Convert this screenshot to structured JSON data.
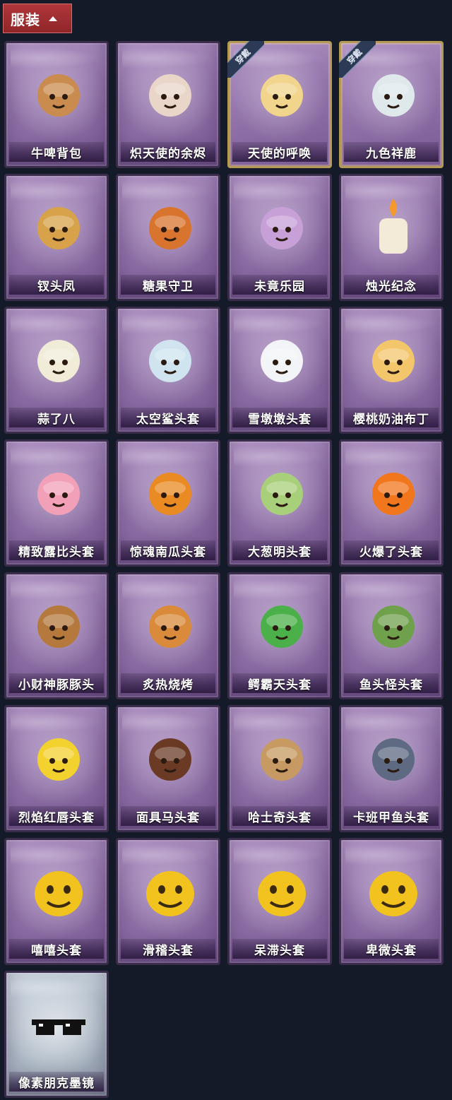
{
  "section": {
    "title": "服装"
  },
  "items": [
    {
      "name": "牛啤背包",
      "icon": "cow-beer-backpack-icon",
      "color": "#c98b4e",
      "equipped": false
    },
    {
      "name": "炽天使的余烬",
      "icon": "seraph-doll-icon",
      "color": "#e9d6c8",
      "equipped": false
    },
    {
      "name": "天使的呼唤",
      "icon": "angel-doll-icon",
      "color": "#f1d58c",
      "equipped": true,
      "badge": "穿戴"
    },
    {
      "name": "九色祥鹿",
      "icon": "deer-charm-icon",
      "color": "#dfe9ec",
      "equipped": true,
      "badge": "穿戴"
    },
    {
      "name": "钗头凤",
      "icon": "phoenix-crown-doll-icon",
      "color": "#d7a24a",
      "equipped": false
    },
    {
      "name": "糖果守卫",
      "icon": "pumpkin-scarecrow-icon",
      "color": "#d8742e",
      "equipped": false
    },
    {
      "name": "未竟乐园",
      "icon": "jester-doll-icon",
      "color": "#c7a0d8",
      "equipped": false
    },
    {
      "name": "烛光纪念",
      "icon": "candle-icon",
      "color": "#f4ead8",
      "equipped": false
    },
    {
      "name": "蒜了八",
      "icon": "garlic-icon",
      "color": "#f0ecd8",
      "equipped": false
    },
    {
      "name": "太空鲨头套",
      "icon": "shark-head-icon",
      "color": "#cfe4ef",
      "equipped": false
    },
    {
      "name": "雪墩墩头套",
      "icon": "snowman-head-icon",
      "color": "#f2f4f7",
      "equipped": false
    },
    {
      "name": "樱桃奶油布丁",
      "icon": "pudding-icon",
      "color": "#f3c66c",
      "equipped": false
    },
    {
      "name": "精致露比头套",
      "icon": "pink-beaver-head-icon",
      "color": "#f2a0b8",
      "equipped": false
    },
    {
      "name": "惊魂南瓜头套",
      "icon": "pumpkin-head-icon",
      "color": "#e98a22",
      "equipped": false
    },
    {
      "name": "大葱明头套",
      "icon": "scallion-head-icon",
      "color": "#a8cf7a",
      "equipped": false
    },
    {
      "name": "火爆了头套",
      "icon": "fire-head-icon",
      "color": "#f2761c",
      "equipped": false
    },
    {
      "name": "小财神豚豚头",
      "icon": "capybara-head-icon",
      "color": "#b5793d",
      "equipped": false
    },
    {
      "name": "炙热烧烤",
      "icon": "bbq-meat-icon",
      "color": "#d98a3a",
      "equipped": false
    },
    {
      "name": "鳄霸天头套",
      "icon": "crocodile-head-icon",
      "color": "#4bb04a",
      "equipped": false
    },
    {
      "name": "鱼头怪头套",
      "icon": "fish-head-icon",
      "color": "#6fa04c",
      "equipped": false
    },
    {
      "name": "烈焰红唇头套",
      "icon": "pikachu-head-icon",
      "color": "#f3d12f",
      "equipped": false
    },
    {
      "name": "面具马头套",
      "icon": "horse-head-icon",
      "color": "#6a3a24",
      "equipped": false
    },
    {
      "name": "哈士奇头套",
      "icon": "husky-head-icon",
      "color": "#c69a62",
      "equipped": false
    },
    {
      "name": "卡班甲鱼头套",
      "icon": "fish-bun-head-icon",
      "color": "#5d6a82",
      "equipped": false
    },
    {
      "name": "嘻嘻头套",
      "icon": "grin-emoji-icon",
      "color": "#f2c21f",
      "equipped": false
    },
    {
      "name": "滑稽头套",
      "icon": "smirk-emoji-icon",
      "color": "#f2c21f",
      "equipped": false
    },
    {
      "name": "呆滞头套",
      "icon": "stare-emoji-icon",
      "color": "#f2c21f",
      "equipped": false
    },
    {
      "name": "卑微头套",
      "icon": "shy-emoji-icon",
      "color": "#f2c21f",
      "equipped": false
    },
    {
      "name": "像素朋克墨镜",
      "icon": "pixel-sunglasses-icon",
      "color": "#111111",
      "equipped": false,
      "pale": true
    }
  ]
}
